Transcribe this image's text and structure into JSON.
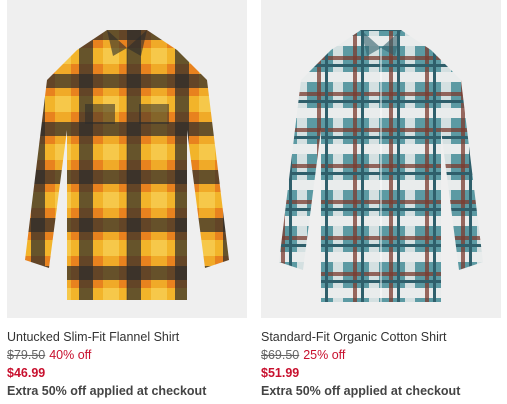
{
  "products": [
    {
      "image_icon": "flannel-shirt-image",
      "name": "Untucked Slim-Fit Flannel Shirt",
      "original_price": "$79.50",
      "discount": "40% off",
      "sale_price": "$46.99",
      "promo": "Extra 50% off applied at checkout",
      "colors": [
        "#e8821e",
        "#f2b42a",
        "#2b2b2b",
        "#c95a18"
      ]
    },
    {
      "image_icon": "plaid-shirt-image",
      "name": "Standard-Fit Organic Cotton Shirt",
      "original_price": "$69.50",
      "discount": "25% off",
      "sale_price": "$51.99",
      "promo": "Extra 50% off applied at checkout",
      "colors": [
        "#5c9aa3",
        "#e9ecec",
        "#7a3b2e",
        "#2f5f6b"
      ]
    }
  ],
  "accent": {
    "sale": "#c8102e",
    "image_bg": "#efefef"
  }
}
